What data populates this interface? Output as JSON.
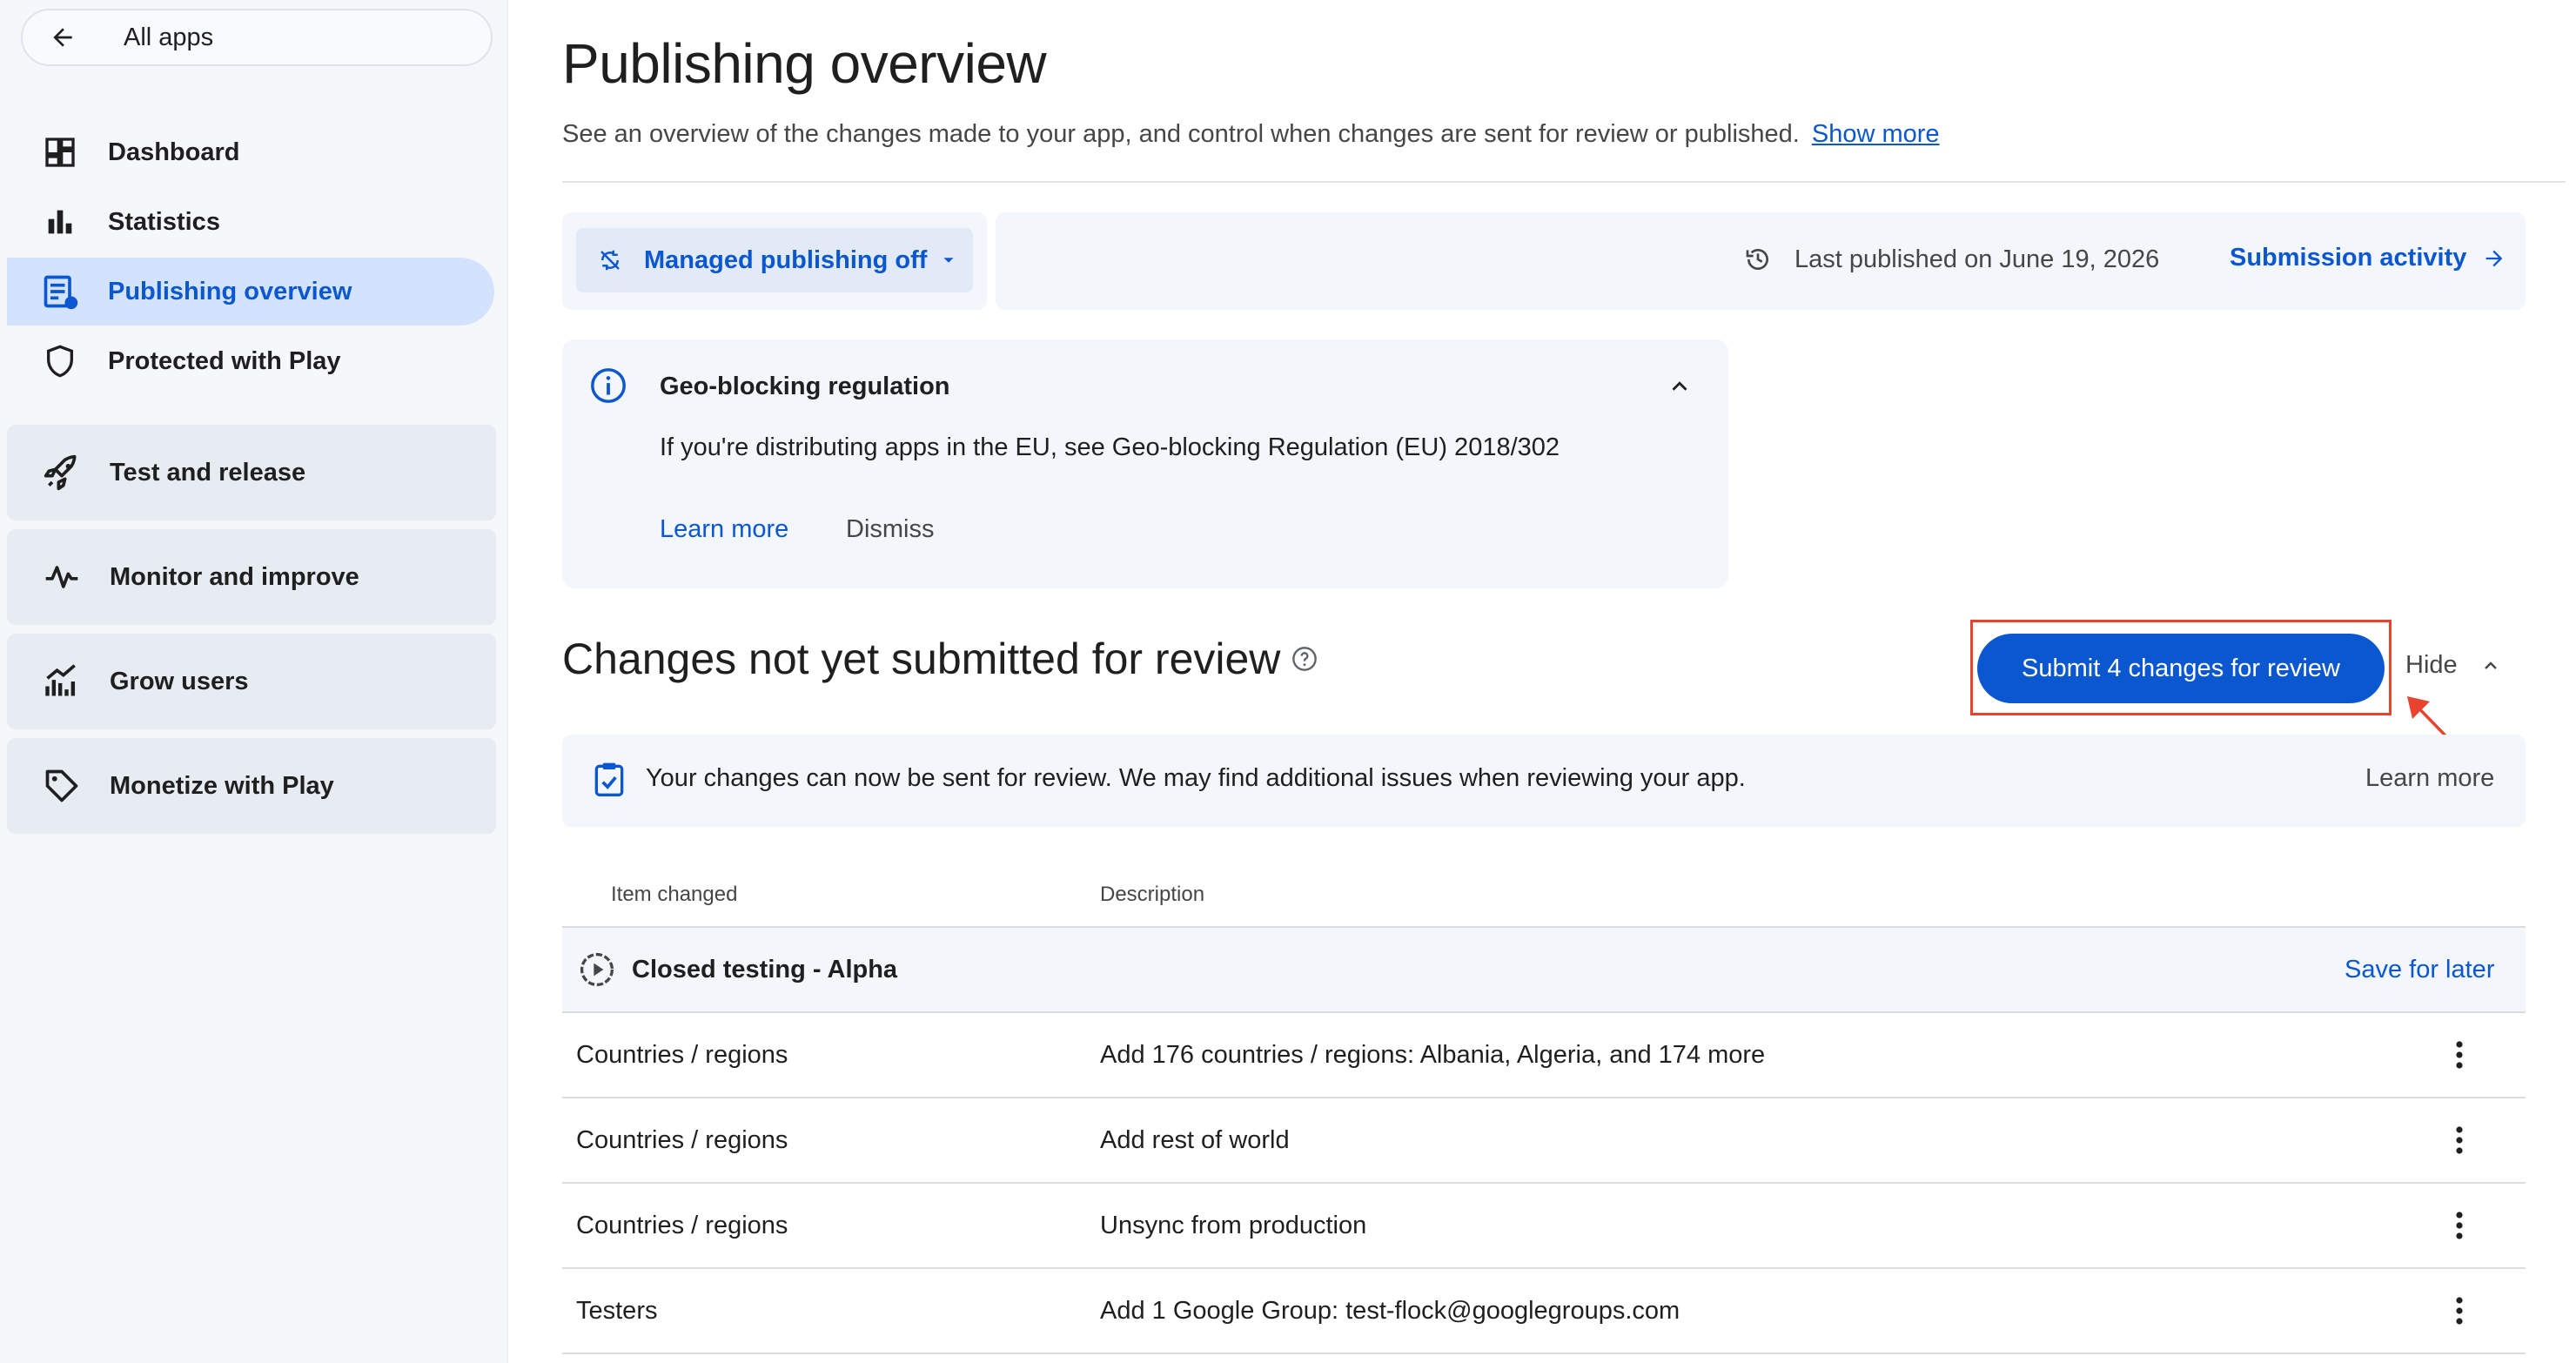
{
  "sidebar": {
    "all_apps_label": "All apps",
    "items": [
      {
        "label": "Dashboard",
        "icon": "dashboard-icon"
      },
      {
        "label": "Statistics",
        "icon": "bar-chart-icon"
      },
      {
        "label": "Publishing overview",
        "icon": "publishing-icon",
        "active": true
      },
      {
        "label": "Protected with Play",
        "icon": "shield-icon"
      }
    ],
    "groups": [
      {
        "label": "Test and release",
        "icon": "rocket-icon"
      },
      {
        "label": "Monitor and improve",
        "icon": "pulse-icon"
      },
      {
        "label": "Grow users",
        "icon": "grow-users-icon"
      },
      {
        "label": "Monetize with Play",
        "icon": "tag-icon"
      }
    ]
  },
  "header": {
    "title": "Publishing overview",
    "description": "See an overview of the changes made to your app, and control when changes are sent for review or published.",
    "show_more": "Show more"
  },
  "publishing_bar": {
    "managed_label": "Managed publishing off",
    "last_published": "Last published on June 19, 2026",
    "submission_activity": "Submission activity"
  },
  "geo_notice": {
    "title": "Geo-blocking regulation",
    "body": "If you're distributing apps in the EU, see Geo-blocking Regulation (EU) 2018/302",
    "learn_more": "Learn more",
    "dismiss": "Dismiss"
  },
  "changes": {
    "title": "Changes not yet submitted for review",
    "submit_label": "Submit 4 changes for review",
    "hide_label": "Hide",
    "notice_text": "Your changes can now be sent for review. We may find additional issues when reviewing your app.",
    "notice_learn_more": "Learn more",
    "columns": [
      "Item changed",
      "Description"
    ],
    "group": {
      "label": "Closed testing - Alpha",
      "action": "Save for later"
    },
    "rows": [
      {
        "item": "Countries / regions",
        "description": "Add 176 countries / regions: Albania, Algeria, and 174 more"
      },
      {
        "item": "Countries / regions",
        "description": "Add rest of world"
      },
      {
        "item": "Countries / regions",
        "description": "Unsync from production"
      },
      {
        "item": "Testers",
        "description": "Add 1 Google Group: test-flock@googlegroups.com"
      }
    ]
  },
  "colors": {
    "accent": "#0b57d0",
    "active_nav_bg": "#d3e3fd",
    "highlight_red": "#e8432e"
  }
}
